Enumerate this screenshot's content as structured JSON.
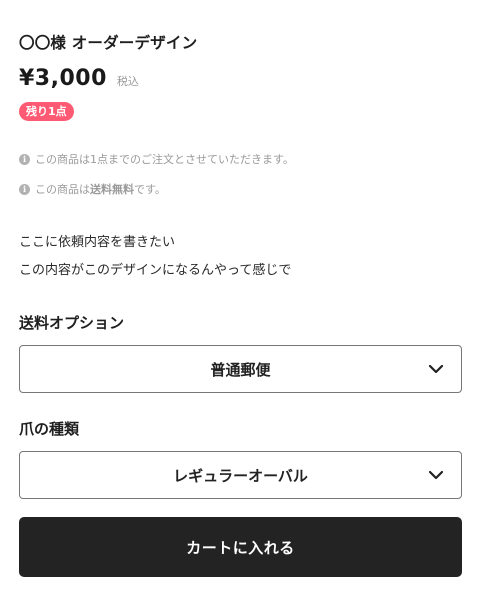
{
  "product": {
    "title": "〇〇様 オーダーデザイン",
    "price": "¥3,000",
    "tax_label": "税込",
    "stock_badge": "残り1点"
  },
  "notes": [
    {
      "icon": "info-icon",
      "text": "この商品は1点までのご注文とさせていただきます。"
    },
    {
      "icon": "info-icon",
      "prefix": "この商品は",
      "bold": "送料無料",
      "suffix": "です。"
    }
  ],
  "description": [
    "ここに依頼内容を書きたい",
    "この内容がこのデザインになるんやって感じで"
  ],
  "options": [
    {
      "label": "送料オプション",
      "selected": "普通郵便"
    },
    {
      "label": "爪の種類",
      "selected": "レギュラーオーバル"
    }
  ],
  "cart_button": "カートに入れる",
  "colors": {
    "badge": "#ff5a73",
    "button": "#232323",
    "muted_text": "#9a9a9a"
  }
}
